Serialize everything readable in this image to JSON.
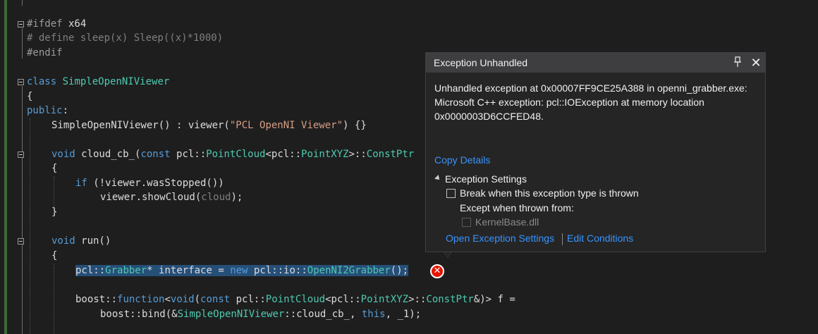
{
  "editor": {
    "lines": {
      "l1_a": "#ifdef",
      "l1_b": " x64",
      "l2_a": "# define ",
      "l2_b": "sleep(x) Sleep((x)*1000)",
      "l3": "#endif",
      "l5_a": "class",
      "l5_b": "SimpleOpenNIViewer",
      "l6": "{",
      "l7_a": "public",
      "l7_b": ":",
      "l8_a": "SimpleOpenNIViewer() : viewer(",
      "l8_b": "\"PCL OpenNI Viewer\"",
      "l8_c": ") {}",
      "l10_a": "void",
      "l10_b": " cloud_cb_(",
      "l10_c": "const",
      "l10_d": " pcl::",
      "l10_e": "PointCloud",
      "l10_f": "<pcl::",
      "l10_g": "PointXYZ",
      "l10_h": ">::",
      "l10_i": "ConstPtr",
      "l11": "{",
      "l12_a": "if",
      "l12_b": " (!viewer.wasStopped())",
      "l13_a": "viewer.showCloud(",
      "l13_b": "cloud",
      "l13_c": ");",
      "l14": "}",
      "l16_a": "void",
      "l16_b": " run()",
      "l17": "{",
      "l18_a": "pcl::",
      "l18_b": "Grabber",
      "l18_c": "* interface = ",
      "l18_d": "new",
      "l18_e": " pcl::io::",
      "l18_f": "OpenNI2Grabber",
      "l18_g": "();",
      "l20_a": "boost::",
      "l20_b": "function",
      "l20_c": "<",
      "l20_d": "void",
      "l20_e": "(",
      "l20_f": "const",
      "l20_g": " pcl::",
      "l20_h": "PointCloud",
      "l20_i": "<pcl::",
      "l20_j": "PointXYZ",
      "l20_k": ">::",
      "l20_l": "ConstPtr",
      "l20_m": "&)> f =",
      "l21_a": "boost::bind(&",
      "l21_b": "SimpleOpenNIViewer",
      "l21_c": "::cloud_cb_, ",
      "l21_d": "this",
      "l21_e": ", _1);"
    }
  },
  "error_glyph": {
    "icon": "error-x-icon",
    "symbol": "✕"
  },
  "popup": {
    "title": "Exception Unhandled",
    "pin_symbol": "📌",
    "close_symbol": "✕",
    "message_line1": "Unhandled exception at 0x00007FF9CE25A388 in openni_grabber.exe:",
    "message_line2": "Microsoft C++ exception: pcl::IOException at memory location",
    "message_line3": "0x0000003D6CCFED48.",
    "copy_details": "Copy Details",
    "settings_header": "Exception Settings",
    "break_label": "Break when this exception type is thrown",
    "except_label": "Except when thrown from:",
    "kernel_label": "KernelBase.dll",
    "open_settings": "Open Exception Settings",
    "edit_conditions": "Edit Conditions"
  },
  "colors": {
    "background": "#1e1e1e",
    "keyword": "#569cd6",
    "type": "#4ec9b0",
    "string": "#d69d85",
    "link": "#3794ff",
    "error": "#e51400",
    "selection": "#264f78"
  }
}
